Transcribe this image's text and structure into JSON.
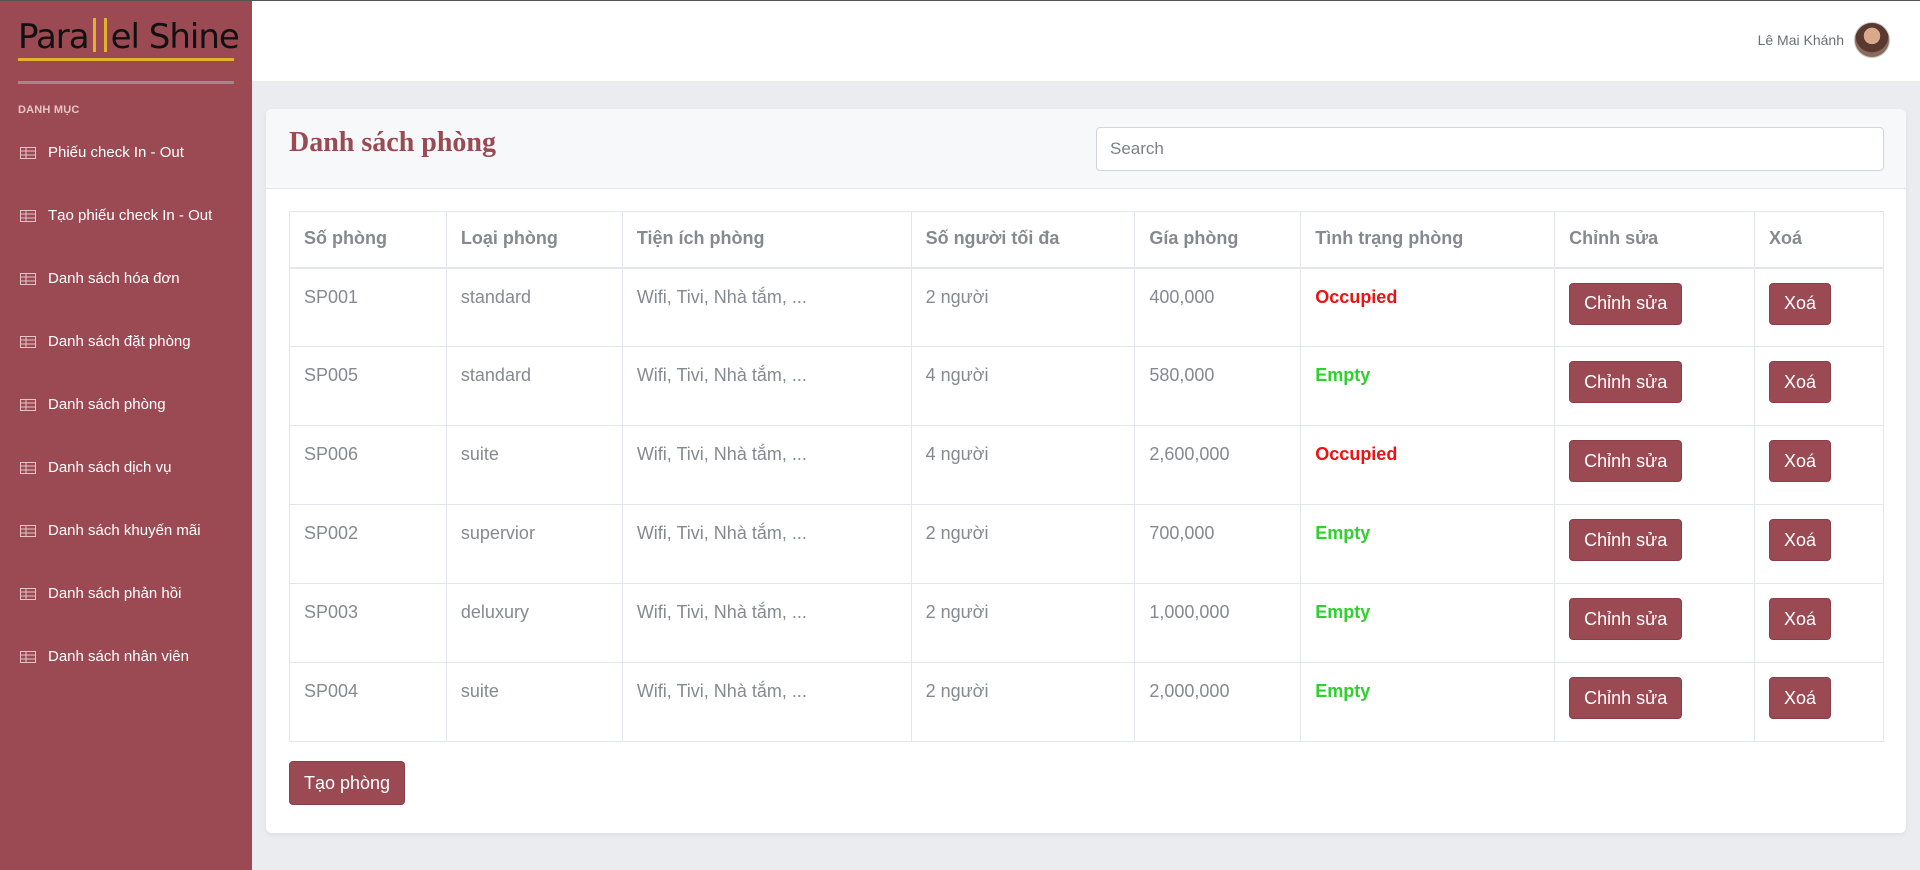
{
  "brand": {
    "part1": "Para",
    "part2": "el Shine"
  },
  "sidebar": {
    "heading": "DANH MỤC",
    "items": [
      {
        "label": "Phiếu check In - Out"
      },
      {
        "label": "Tạo phiếu check In - Out"
      },
      {
        "label": "Danh sách hóa đơn"
      },
      {
        "label": "Danh sách đặt phòng"
      },
      {
        "label": "Danh sách phòng"
      },
      {
        "label": "Danh sách dịch vụ"
      },
      {
        "label": "Danh sách khuyến mãi"
      },
      {
        "label": "Danh sách phản hồi"
      },
      {
        "label": "Danh sách nhân viên"
      }
    ]
  },
  "header": {
    "user_name": "Lê Mai Khánh"
  },
  "main": {
    "title": "Danh sách phòng",
    "search_placeholder": "Search",
    "columns": [
      "Số phòng",
      "Loại phòng",
      "Tiện ích phòng",
      "Số người tối đa",
      "Gía phòng",
      "Tình trạng phòng",
      "Chỉnh sửa",
      "Xoá"
    ],
    "rows": [
      {
        "id": "SP001",
        "type": "standard",
        "amenities": "Wifi, Tivi, Nhà tắm, ...",
        "max": "2 người",
        "price": "400,000",
        "status": "Occupied",
        "edit": "Chỉnh sửa",
        "delete": "Xoá"
      },
      {
        "id": "SP005",
        "type": "standard",
        "amenities": "Wifi, Tivi, Nhà tắm, ...",
        "max": "4 người",
        "price": "580,000",
        "status": "Empty",
        "edit": "Chỉnh sửa",
        "delete": "Xoá"
      },
      {
        "id": "SP006",
        "type": "suite",
        "amenities": "Wifi, Tivi, Nhà tắm, ...",
        "max": "4 người",
        "price": "2,600,000",
        "status": "Occupied",
        "edit": "Chỉnh sửa",
        "delete": "Xoá"
      },
      {
        "id": "SP002",
        "type": "supervior",
        "amenities": "Wifi, Tivi, Nhà tắm, ...",
        "max": "2 người",
        "price": "700,000",
        "status": "Empty",
        "edit": "Chỉnh sửa",
        "delete": "Xoá"
      },
      {
        "id": "SP003",
        "type": "deluxury",
        "amenities": "Wifi, Tivi, Nhà tắm, ...",
        "max": "2 người",
        "price": "1,000,000",
        "status": "Empty",
        "edit": "Chỉnh sửa",
        "delete": "Xoá"
      },
      {
        "id": "SP004",
        "type": "suite",
        "amenities": "Wifi, Tivi, Nhà tắm, ...",
        "max": "2 người",
        "price": "2,000,000",
        "status": "Empty",
        "edit": "Chỉnh sửa",
        "delete": "Xoá"
      }
    ],
    "create_label": "Tạo phòng"
  },
  "colors": {
    "primary": "#9b4a54",
    "accent": "#e1b22b",
    "occupied": "#ee1111",
    "empty": "#2ed12e"
  }
}
